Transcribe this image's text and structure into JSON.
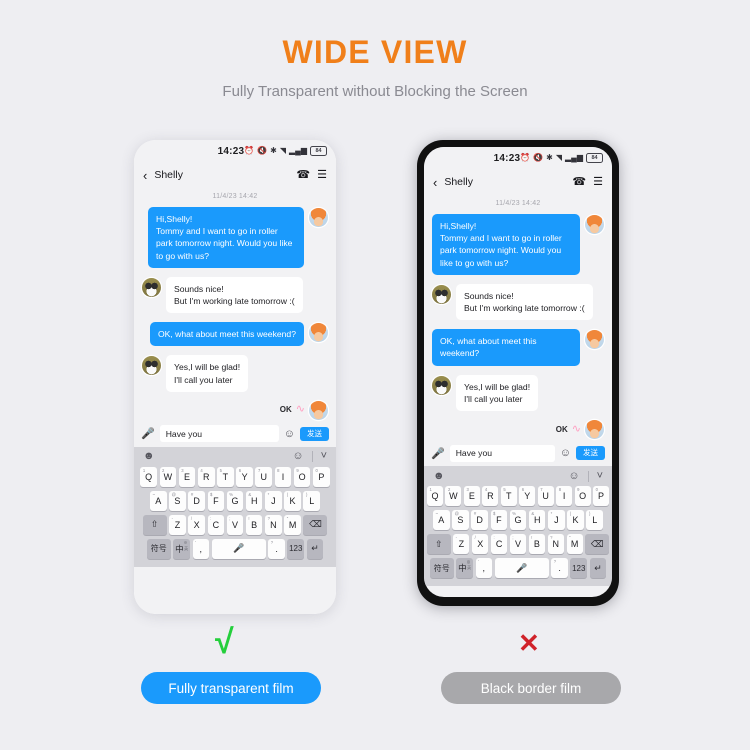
{
  "header": {
    "title": "WIDE VIEW",
    "subtitle": "Fully Transparent without Blocking the Screen",
    "title_color": "#f07f1a",
    "subtitle_color": "#8a8a92"
  },
  "background_color": "#eeeef2",
  "phone": {
    "status_bar": {
      "time": "14:23",
      "battery_level": "84",
      "icons": [
        "alarm-icon",
        "mute-icon",
        "bluetooth-icon",
        "wifi-icon",
        "signal-icon",
        "battery-icon"
      ]
    },
    "nav_bar": {
      "back_icon": "chevron-left-icon",
      "contact_name": "Shelly",
      "call_icon": "phone-icon",
      "menu_icon": "hamburger-menu-icon"
    },
    "chat": {
      "timestamp": "11/4/23 14:42",
      "messages": [
        {
          "side": "out",
          "text": "Hi,Shelly!\nTommy and I want to go in roller park tomorrow night. Would you like to go with us?",
          "avatar": "girl-avatar"
        },
        {
          "side": "in",
          "text": "Sounds nice!\nBut I'm working late tomorrow :(",
          "avatar": "dog-avatar"
        },
        {
          "side": "out",
          "text": "OK, what about meet this weekend?",
          "avatar": "girl-avatar"
        },
        {
          "side": "in",
          "text": "Yes,I will be glad!\nI'll call you later",
          "avatar": "dog-avatar"
        }
      ],
      "sticker_label": "OK",
      "bubble_out_color": "#1a9afc",
      "bubble_in_color": "#ffffff"
    },
    "input_bar": {
      "mic_icon": "microphone-icon",
      "text_value": "Have you",
      "emoji_icon": "emoji-smiley-icon",
      "send_label": "发送"
    },
    "keyboard": {
      "toolbar": {
        "sticker_icon": "sticker-face-icon",
        "emoji_icon": "emoji-smiley-icon",
        "collapse_icon": "chevron-down-icon"
      },
      "row1": [
        {
          "label": "Q",
          "sup": "1"
        },
        {
          "label": "W",
          "sup": "2"
        },
        {
          "label": "E",
          "sup": "3"
        },
        {
          "label": "R",
          "sup": "4"
        },
        {
          "label": "T",
          "sup": "5"
        },
        {
          "label": "Y",
          "sup": "6"
        },
        {
          "label": "U",
          "sup": "7"
        },
        {
          "label": "I",
          "sup": "8"
        },
        {
          "label": "O",
          "sup": "9"
        },
        {
          "label": "P",
          "sup": "0"
        }
      ],
      "row2": [
        {
          "label": "A",
          "sup": "~"
        },
        {
          "label": "S",
          "sup": "@"
        },
        {
          "label": "D",
          "sup": "#"
        },
        {
          "label": "F",
          "sup": "$"
        },
        {
          "label": "G",
          "sup": "%"
        },
        {
          "label": "H",
          "sup": "&"
        },
        {
          "label": "J",
          "sup": "*"
        },
        {
          "label": "K",
          "sup": "("
        },
        {
          "label": "L",
          "sup": ")"
        }
      ],
      "row3": {
        "shift_label": "⇧",
        "keys": [
          {
            "label": "Z",
            "sup": "-"
          },
          {
            "label": "X",
            "sup": "/"
          },
          {
            "label": "C",
            "sup": ":"
          },
          {
            "label": "V",
            "sup": ";"
          },
          {
            "label": "B",
            "sup": "!"
          },
          {
            "label": "N",
            "sup": "?"
          },
          {
            "label": "M",
            "sup": "\""
          }
        ],
        "backspace_label": "⌫"
      },
      "row4": {
        "symbol_label": "符号",
        "lang_label": "中",
        "lang_sub": "英",
        "comma_label": ",",
        "comma_sup": "'",
        "space_icon": "microphone-icon",
        "period_label": ".",
        "period_sup": "?",
        "num_label": "123",
        "enter_label": "↵"
      }
    }
  },
  "footer": {
    "check_mark": "√",
    "cross_mark": "✕",
    "good_label": "Fully transparent film",
    "bad_label": "Black border film",
    "good_color": "#1a9afc",
    "bad_color": "#a8a8ab",
    "check_color": "#24cf3c",
    "cross_color": "#d0222a"
  }
}
